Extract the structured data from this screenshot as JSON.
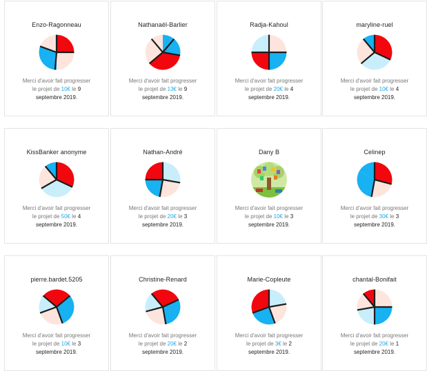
{
  "colors": {
    "red": "#f2070f",
    "blue": "#18b1f2",
    "peach": "#fde5dd",
    "sky": "#c9eefb",
    "line": "#1c1c1c",
    "accent": "#1ea7e8"
  },
  "message": {
    "before": "Merci d'avoir fait progresser",
    "projet": "le projet de",
    "le": "le"
  },
  "cards": [
    {
      "name": "Enzo-Ragonneau",
      "amount": "10€",
      "day": "9",
      "date_end": "septembre 2019.",
      "avatar": "pinwheel",
      "avatar_icon": "pinwheel-avatar-icon",
      "segments": [
        {
          "a": 0,
          "b": 90,
          "c": "red"
        },
        {
          "a": 90,
          "b": 180,
          "c": "peach"
        },
        {
          "a": 180,
          "b": 290,
          "c": "blue"
        },
        {
          "a": 290,
          "b": 360,
          "c": "peach"
        }
      ],
      "spokes": [
        0,
        90,
        185,
        290
      ]
    },
    {
      "name": "Nathanaël-Barlier",
      "amount": "13€",
      "day": "9",
      "date_end": "septembre 2019.",
      "avatar": "pinwheel",
      "avatar_icon": "pinwheel-avatar-icon",
      "segments": [
        {
          "a": 0,
          "b": 100,
          "c": "blue"
        },
        {
          "a": 100,
          "b": 230,
          "c": "red"
        },
        {
          "a": 230,
          "b": 320,
          "c": "peach"
        },
        {
          "a": 320,
          "b": 360,
          "c": "peach"
        }
      ],
      "spokes": [
        40,
        100,
        230,
        320
      ]
    },
    {
      "name": "Radja-Kahoul",
      "amount": "20€",
      "day": "4",
      "date_end": "septembre 2019.",
      "avatar": "pinwheel",
      "avatar_icon": "pinwheel-avatar-icon",
      "segments": [
        {
          "a": 0,
          "b": 90,
          "c": "peach"
        },
        {
          "a": 90,
          "b": 180,
          "c": "blue"
        },
        {
          "a": 180,
          "b": 270,
          "c": "red"
        },
        {
          "a": 270,
          "b": 360,
          "c": "sky"
        }
      ],
      "spokes": [
        0,
        90,
        180,
        270
      ]
    },
    {
      "name": "maryline-ruel",
      "amount": "10€",
      "day": "4",
      "date_end": "septembre 2019.",
      "avatar": "pinwheel",
      "avatar_icon": "pinwheel-avatar-icon",
      "segments": [
        {
          "a": 320,
          "b": 360,
          "c": "blue"
        },
        {
          "a": 0,
          "b": 115,
          "c": "red"
        },
        {
          "a": 115,
          "b": 230,
          "c": "sky"
        },
        {
          "a": 230,
          "b": 320,
          "c": "peach"
        }
      ],
      "spokes": [
        0,
        115,
        230,
        320
      ]
    },
    {
      "name": "KissBanker anonyme",
      "amount": "50€",
      "day": "4",
      "date_end": "septembre 2019.",
      "avatar": "pinwheel",
      "avatar_icon": "pinwheel-avatar-icon",
      "segments": [
        {
          "a": 320,
          "b": 360,
          "c": "blue"
        },
        {
          "a": 0,
          "b": 115,
          "c": "red"
        },
        {
          "a": 115,
          "b": 240,
          "c": "sky"
        },
        {
          "a": 240,
          "b": 320,
          "c": "peach"
        }
      ],
      "spokes": [
        0,
        115,
        240,
        320
      ]
    },
    {
      "name": "Nathan-André",
      "amount": "20€",
      "day": "3",
      "date_end": "septembre 2019.",
      "avatar": "pinwheel",
      "avatar_icon": "pinwheel-avatar-icon",
      "segments": [
        {
          "a": 0,
          "b": 100,
          "c": "sky"
        },
        {
          "a": 100,
          "b": 190,
          "c": "peach"
        },
        {
          "a": 190,
          "b": 270,
          "c": "blue"
        },
        {
          "a": 270,
          "b": 360,
          "c": "red"
        }
      ],
      "spokes": [
        0,
        100,
        190,
        270
      ]
    },
    {
      "name": "Dany B",
      "amount": "10€",
      "day": "3",
      "date_end": "septembre 2019.",
      "avatar": "photo",
      "avatar_icon": "tree-photo-avatar-icon",
      "segments": [],
      "spokes": []
    },
    {
      "name": "Celinep",
      "amount": "30€",
      "day": "3",
      "date_end": "septembre 2019.",
      "avatar": "pinwheel",
      "avatar_icon": "pinwheel-avatar-icon",
      "segments": [
        {
          "a": 0,
          "b": 105,
          "c": "red"
        },
        {
          "a": 105,
          "b": 190,
          "c": "peach"
        },
        {
          "a": 190,
          "b": 300,
          "c": "blue"
        },
        {
          "a": 300,
          "b": 360,
          "c": "blue"
        }
      ],
      "spokes": [
        0,
        105,
        190
      ]
    },
    {
      "name": "pierre.bardet.5205",
      "amount": "10€",
      "day": "3",
      "date_end": "septembre 2019.",
      "avatar": "pinwheel",
      "avatar_icon": "pinwheel-avatar-icon",
      "segments": [
        {
          "a": 0,
          "b": 50,
          "c": "red"
        },
        {
          "a": 50,
          "b": 160,
          "c": "blue"
        },
        {
          "a": 160,
          "b": 250,
          "c": "peach"
        },
        {
          "a": 250,
          "b": 310,
          "c": "sky"
        },
        {
          "a": 310,
          "b": 360,
          "c": "red"
        }
      ],
      "spokes": [
        50,
        160,
        250,
        310
      ]
    },
    {
      "name": "Christine-Renard",
      "amount": "20€",
      "day": "2",
      "date_end": "septembre 2019.",
      "avatar": "pinwheel",
      "avatar_icon": "pinwheel-avatar-icon",
      "segments": [
        {
          "a": 0,
          "b": 65,
          "c": "red"
        },
        {
          "a": 65,
          "b": 170,
          "c": "blue"
        },
        {
          "a": 170,
          "b": 255,
          "c": "peach"
        },
        {
          "a": 255,
          "b": 320,
          "c": "sky"
        },
        {
          "a": 320,
          "b": 360,
          "c": "red"
        }
      ],
      "spokes": [
        65,
        170,
        255,
        320
      ]
    },
    {
      "name": "Marie-Copleute",
      "amount": "3€",
      "day": "2",
      "date_end": "septembre 2019.",
      "avatar": "pinwheel",
      "avatar_icon": "pinwheel-avatar-icon",
      "segments": [
        {
          "a": 0,
          "b": 80,
          "c": "sky"
        },
        {
          "a": 80,
          "b": 160,
          "c": "peach"
        },
        {
          "a": 160,
          "b": 250,
          "c": "blue"
        },
        {
          "a": 250,
          "b": 360,
          "c": "red"
        }
      ],
      "spokes": [
        0,
        80,
        160,
        250
      ]
    },
    {
      "name": "chantal-Bonifait",
      "amount": "20€",
      "day": "1",
      "date_end": "septembre 2019.",
      "avatar": "pinwheel",
      "avatar_icon": "pinwheel-avatar-icon",
      "segments": [
        {
          "a": 0,
          "b": 90,
          "c": "peach"
        },
        {
          "a": 90,
          "b": 180,
          "c": "blue"
        },
        {
          "a": 180,
          "b": 260,
          "c": "sky"
        },
        {
          "a": 260,
          "b": 320,
          "c": "peach"
        },
        {
          "a": 320,
          "b": 360,
          "c": "red"
        }
      ],
      "spokes": [
        0,
        90,
        180,
        260,
        320
      ]
    }
  ]
}
